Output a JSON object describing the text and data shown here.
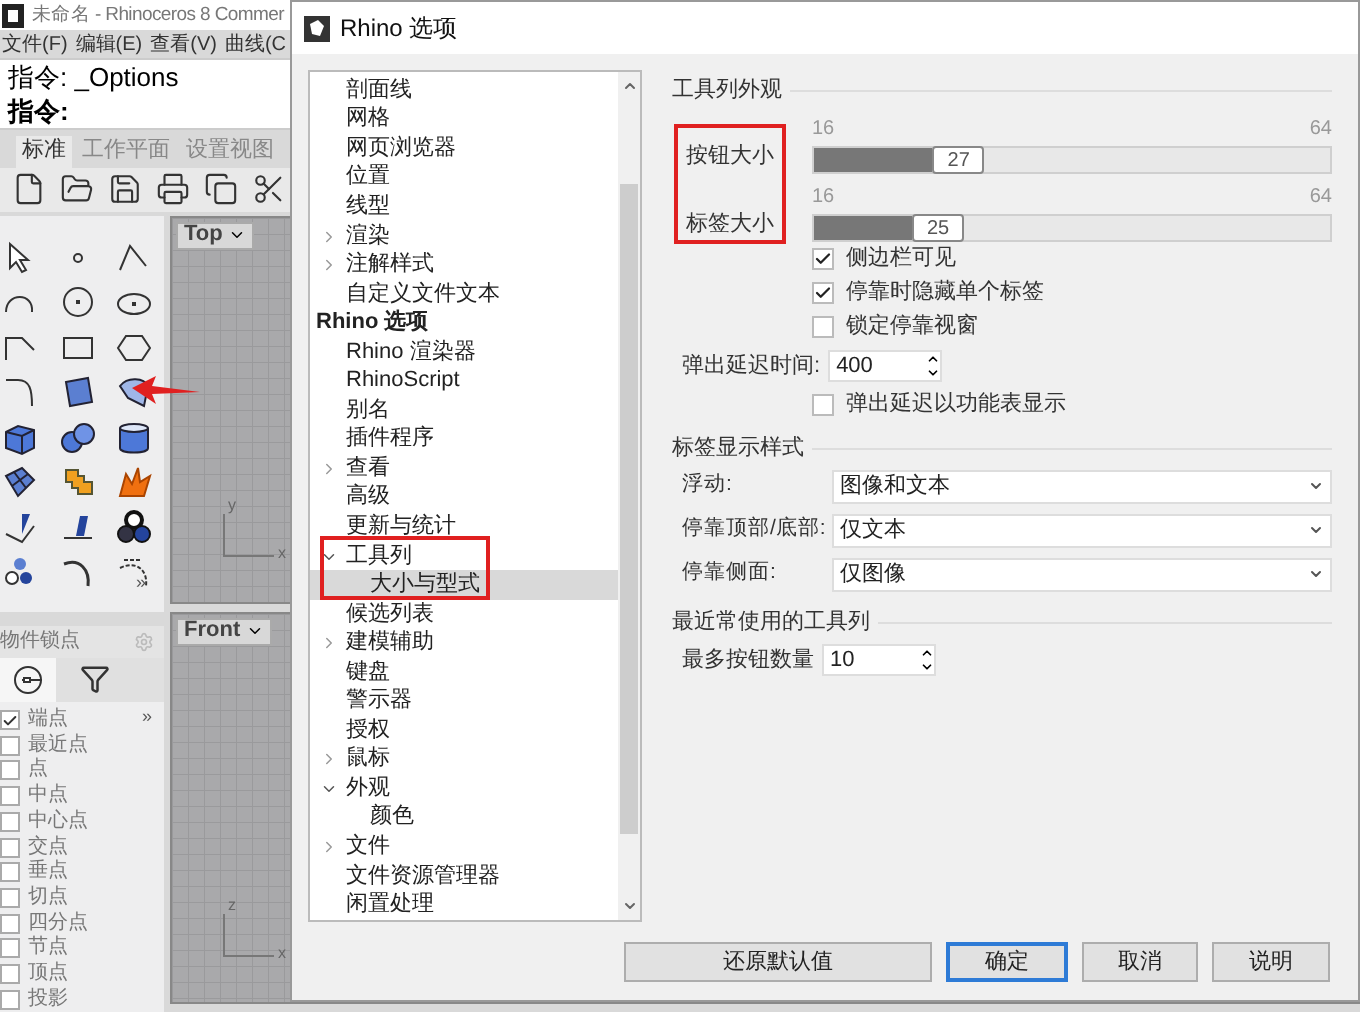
{
  "app": {
    "title": "未命名 - Rhinoceros 8 Commer",
    "menu": [
      "文件(F)",
      "编辑(E)",
      "查看(V)",
      "曲线(C"
    ],
    "command_lines": [
      {
        "text": "指令: _Options",
        "bold": false
      },
      {
        "text": "指令:",
        "bold": true
      }
    ],
    "tabs": [
      {
        "label": "标准",
        "selected": true
      },
      {
        "label": "工作平面",
        "selected": false
      },
      {
        "label": "设置视图",
        "selected": false
      }
    ],
    "palette_more": "»",
    "viewports": [
      {
        "label": "Top",
        "axes": [
          "y",
          "x"
        ]
      },
      {
        "label": "Front",
        "axes": [
          "z",
          "x"
        ]
      }
    ],
    "snap_panel": {
      "title": "物件锁点",
      "more": "»",
      "items": [
        {
          "label": "端点",
          "checked": true
        },
        {
          "label": "最近点",
          "checked": false
        },
        {
          "label": "点",
          "checked": false
        },
        {
          "label": "中点",
          "checked": false
        },
        {
          "label": "中心点",
          "checked": false
        },
        {
          "label": "交点",
          "checked": false
        },
        {
          "label": "垂点",
          "checked": false
        },
        {
          "label": "切点",
          "checked": false
        },
        {
          "label": "四分点",
          "checked": false
        },
        {
          "label": "节点",
          "checked": false
        },
        {
          "label": "顶点",
          "checked": false
        },
        {
          "label": "投影",
          "checked": false
        }
      ]
    }
  },
  "dialog": {
    "title": "Rhino 选项",
    "tree": [
      {
        "label": "剖面线",
        "selected": false
      },
      {
        "label": "网格",
        "selected": false
      },
      {
        "label": "网页浏览器",
        "selected": false
      },
      {
        "label": "位置",
        "selected": false
      },
      {
        "label": "线型",
        "selected": false
      },
      {
        "label": "渲染",
        "selected": false,
        "expanded": false
      },
      {
        "label": "注解样式",
        "selected": false,
        "expanded": false
      },
      {
        "label": "自定义文件文本",
        "selected": false
      }
    ],
    "tree_roots": [
      {
        "label": "Rhino 选项",
        "selected": false,
        "children": [
          {
            "label": "Rhino 渲染器",
            "selected": false
          },
          {
            "label": "RhinoScript",
            "selected": false
          },
          {
            "label": "别名",
            "selected": false
          },
          {
            "label": "插件程序",
            "selected": false
          },
          {
            "label": "查看",
            "selected": false,
            "expanded": false
          },
          {
            "label": "高级",
            "selected": false
          },
          {
            "label": "更新与统计",
            "selected": false
          },
          {
            "label": "工具列",
            "selected": false,
            "expanded": true,
            "children": [
              {
                "label": "大小与型式",
                "selected": true
              }
            ]
          },
          {
            "label": "候选列表",
            "selected": false
          },
          {
            "label": "建模辅助",
            "selected": false,
            "expanded": false
          },
          {
            "label": "键盘",
            "selected": false
          },
          {
            "label": "警示器",
            "selected": false
          },
          {
            "label": "授权",
            "selected": false
          },
          {
            "label": "鼠标",
            "selected": false,
            "expanded": false
          },
          {
            "label": "外观",
            "selected": false,
            "expanded": true,
            "children": [
              {
                "label": "颜色",
                "selected": false
              }
            ]
          },
          {
            "label": "文件",
            "selected": false,
            "expanded": false
          },
          {
            "label": "文件资源管理器",
            "selected": false
          },
          {
            "label": "闲置处理",
            "selected": false
          }
        ]
      }
    ],
    "sections": [
      {
        "title": "工具列外观",
        "rows": [
          {
            "kind": "slider",
            "label": "按钮大小",
            "min": "16",
            "max": "64",
            "value": "27",
            "level": 0.23
          },
          {
            "kind": "slider",
            "label": "标签大小",
            "min": "16",
            "max": "64",
            "value": "25",
            "level": 0.19
          },
          {
            "kind": "checkbox",
            "label": "侧边栏可见",
            "checked": true
          },
          {
            "kind": "checkbox",
            "label": "停靠时隐藏单个标签",
            "checked": true
          },
          {
            "kind": "checkbox",
            "label": "锁定停靠视窗",
            "checked": false
          },
          {
            "kind": "spinner",
            "label": "弹出延迟时间:",
            "value": "400"
          },
          {
            "kind": "checkbox",
            "label": "弹出延迟以功能表显示",
            "checked": false
          }
        ]
      },
      {
        "title": "标签显示样式",
        "rows": [
          {
            "kind": "dropdown",
            "label": "浮动:",
            "value": "图像和文本"
          },
          {
            "kind": "dropdown",
            "label": "停靠顶部/底部:",
            "value": "仅文本"
          },
          {
            "kind": "dropdown",
            "label": "停靠侧面:",
            "value": "仅图像"
          }
        ]
      },
      {
        "title": "最近常使用的工具列",
        "rows": [
          {
            "kind": "spinner",
            "label": "最多按钮数量",
            "value": "10"
          }
        ]
      }
    ],
    "buttons": [
      {
        "label": "还原默认值",
        "focused": false
      },
      {
        "label": "确定",
        "focused": true
      },
      {
        "label": "取消",
        "focused": false
      },
      {
        "label": "说明",
        "focused": false
      }
    ]
  }
}
